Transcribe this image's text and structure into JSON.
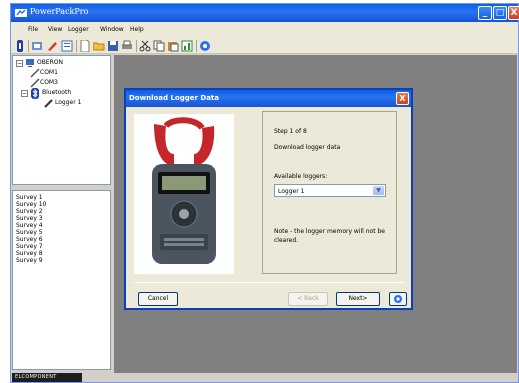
{
  "window": {
    "title": "PowerPackPro"
  },
  "menu": [
    "File",
    "View",
    "Logger",
    "Window",
    "Help"
  ],
  "toolbar": {
    "icons": [
      "info-icon",
      "settings-icon",
      "edit-icon",
      "list-icon",
      "new-document-icon",
      "open-folder-icon",
      "save-icon",
      "print-icon",
      "cut-icon",
      "copy-icon",
      "paste-icon",
      "chart-icon",
      "help-icon"
    ]
  },
  "tree": {
    "root": "OBERON",
    "children": [
      "COM1",
      "COM3",
      "Bluetooth"
    ],
    "grandchild": "Logger 1"
  },
  "surveys": [
    "Survey 1",
    "Survey 10",
    "Survey 2",
    "Survey 3",
    "Survey 4",
    "Survey 5",
    "Survey 6",
    "Survey 7",
    "Survey 8",
    "Survey 9"
  ],
  "brand": {
    "logo_text": "ELCOMPONENT"
  },
  "dialog": {
    "title": "Download Logger Data",
    "step": "Step 1 of 8",
    "description": "Download logger data",
    "loggers_label": "Available loggers:",
    "selected_logger": "Logger 1",
    "note": "Note - the logger memory will not be cleared.",
    "cancel_label": "Cancel",
    "back_label": "< Back",
    "next_label": "Next>"
  },
  "colors": {
    "titlebar": "#1553d6",
    "workspace": "#808080",
    "dialog_bg": "#ece9d8"
  }
}
